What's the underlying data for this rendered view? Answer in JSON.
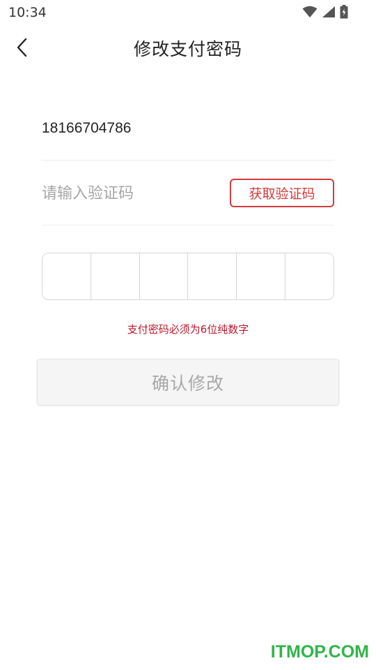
{
  "status_bar": {
    "time": "10:34",
    "icons": [
      "wifi-icon",
      "cellular-signal-icon",
      "battery-charging-icon"
    ]
  },
  "header": {
    "title": "修改支付密码",
    "back_icon": "chevron-left-icon"
  },
  "form": {
    "phone_number": "18166704786",
    "code_placeholder": "请输入验证码",
    "code_value": "",
    "get_code_label": "获取验证码",
    "password_digits": [
      "",
      "",
      "",
      "",
      "",
      ""
    ],
    "hint": "支付密码必须为6位纯数字",
    "confirm_label": "确认修改"
  },
  "watermark": "ITMOP.COM",
  "colors": {
    "accent_red": "#d43a3a",
    "hint_red": "#c0192e",
    "disabled_text": "#a8a8a8",
    "disabled_bg": "#f5f5f5",
    "watermark_green": "#2fb54a"
  }
}
